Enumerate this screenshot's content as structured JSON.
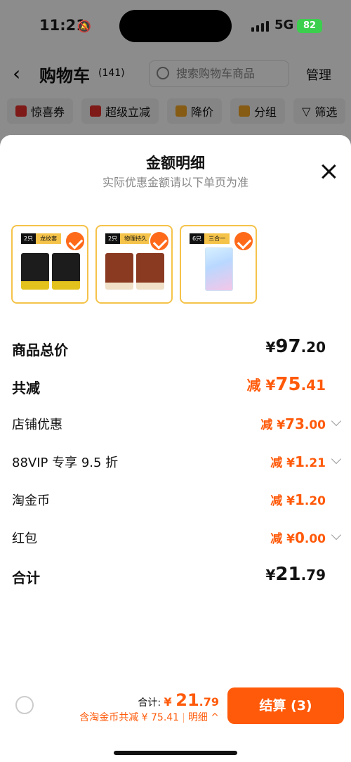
{
  "status": {
    "time": "11:21",
    "network": "5G",
    "battery": "82"
  },
  "nav": {
    "title": "购物车",
    "count": "(141)",
    "search_placeholder": "搜索购物车商品",
    "manage": "管理"
  },
  "filters": [
    {
      "label": "惊喜券",
      "color": "#e5322d"
    },
    {
      "label": "超级立减",
      "color": "#e5322d"
    },
    {
      "label": "降价",
      "color": "#f5a623"
    },
    {
      "label": "分组",
      "color": "#f5a623"
    },
    {
      "label": "筛选",
      "color": "#333333"
    }
  ],
  "sheet": {
    "title": "金额明细",
    "subtitle": "实际优惠金额请以下单页为准"
  },
  "products": [
    {
      "qty": "2只",
      "name": "龙纹套"
    },
    {
      "qty": "2只",
      "name": "物理持久"
    },
    {
      "qty": "6只",
      "name": "三合一"
    }
  ],
  "rows": [
    {
      "label": "商品总价",
      "currency": "¥",
      "int": "97",
      "dec": ".20"
    },
    {
      "label": "共减",
      "prefix": "减",
      "currency": "¥",
      "int": "75",
      "dec": ".41"
    },
    {
      "label": "店铺优惠",
      "prefix": "减",
      "currency": "¥",
      "int": "73",
      "dec": ".00"
    },
    {
      "label": "88VIP 专享 9.5 折",
      "prefix": "减",
      "currency": "¥",
      "int": "1",
      "dec": ".21"
    },
    {
      "label": "淘金币",
      "prefix": "减",
      "currency": "¥",
      "int": "1",
      "dec": ".20"
    },
    {
      "label": "红包",
      "prefix": "减",
      "currency": "¥",
      "int": "0",
      "dec": ".00"
    },
    {
      "label": "合计",
      "currency": "¥",
      "int": "21",
      "dec": ".79"
    }
  ],
  "footer": {
    "total_label": "合计:",
    "currency": "¥",
    "total_int": "21",
    "total_dec": ".79",
    "saved_text": "含淘金币共减 ¥ 75.41",
    "detail_label": "明细",
    "checkout_label": "结算 (3)"
  },
  "colors": {
    "accent": "#ff5a0a",
    "gold": "#f5c34a"
  }
}
